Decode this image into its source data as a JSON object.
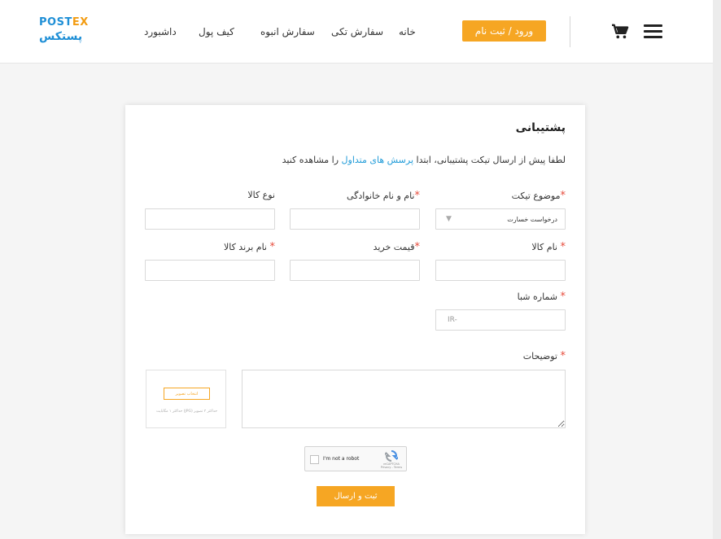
{
  "header": {
    "logo_en_prefix": "POST",
    "logo_en_suffix": "EX",
    "logo_fa": "پستکس",
    "nav": {
      "home": "خانه",
      "single_order": "سفارش تکی",
      "bulk_order": "سفارش انبوه",
      "wallet": "کیف پول",
      "dashboard": "داشبورد"
    },
    "login_label": "ورود / ثبت نام",
    "icons": {
      "cart": "cart-icon",
      "menu": "hamburger-menu-icon"
    },
    "accent_color": "#f6a623"
  },
  "form": {
    "title": "پشتیبانی",
    "intro_before": "لطفا پیش از ارسال تیکت پشتیبانی، ابتدا ",
    "intro_link": "پرسش های متداول",
    "intro_after": " را مشاهده کنید",
    "required_mark": "*",
    "fields": {
      "ticket_subject_label": "موضوع تیکت",
      "ticket_subject_value": "درخواست خسارت",
      "full_name_label": "نام و نام خانوادگی",
      "product_type_label": "نوع کالا",
      "product_name_label": "نام کالا",
      "purchase_price_label": "قیمت خرید",
      "brand_name_label": "نام برند کالا",
      "sheba_label": "شماره شبا",
      "sheba_placeholder": "IR-",
      "description_label": "توضیحات"
    },
    "upload": {
      "button_label": "انتخاب تصویر",
      "note": "حداکثر ۳ تصویر (JPG) حداکثر ۱ مگابایت"
    },
    "captcha": {
      "label": "I'm not a robot",
      "brand": "reCAPTCHA",
      "links": "Privacy - Terms"
    },
    "submit_label": "ثبت و ارسال"
  }
}
